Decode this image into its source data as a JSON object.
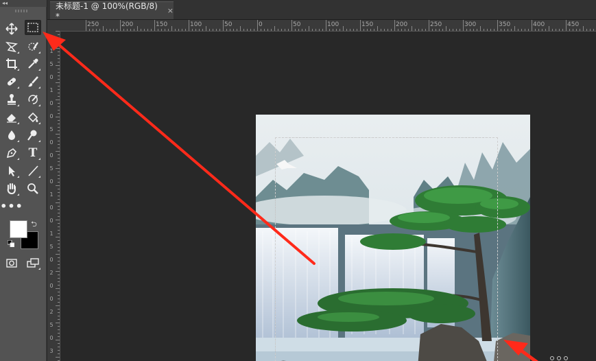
{
  "tab": {
    "title": "未标题-1 @ 100%(RGB/8) *",
    "close": "×"
  },
  "toolbar": {
    "collapse": "◂◂",
    "tools": [
      {
        "name": "move-icon"
      },
      {
        "name": "rect-marquee-icon",
        "active": true
      },
      {
        "name": "lasso-icon"
      },
      {
        "name": "quick-select-icon"
      },
      {
        "name": "crop-icon"
      },
      {
        "name": "eyedropper-icon"
      },
      {
        "name": "healing-icon"
      },
      {
        "name": "brush-icon"
      },
      {
        "name": "stamp-icon"
      },
      {
        "name": "history-brush-icon"
      },
      {
        "name": "eraser-icon"
      },
      {
        "name": "paint-bucket-icon"
      },
      {
        "name": "blur-icon"
      },
      {
        "name": "dodge-icon"
      },
      {
        "name": "pen-icon"
      },
      {
        "name": "type-icon",
        "text": "T"
      },
      {
        "name": "path-select-icon"
      },
      {
        "name": "line-icon"
      },
      {
        "name": "hand-icon"
      },
      {
        "name": "zoom-icon"
      },
      {
        "name": "more-tools-icon",
        "text": "•••"
      }
    ],
    "foreground": "#ffffff",
    "background": "#000000"
  },
  "ruler_h": [
    "250",
    "200",
    "150",
    "100",
    "50",
    "0",
    "50",
    "100",
    "150",
    "200",
    "250",
    "300",
    "350",
    "400",
    "450"
  ],
  "ruler_v": [
    "1",
    "5",
    "0",
    "1",
    "0",
    "0",
    "5",
    "0",
    "0",
    "5",
    "0",
    "1",
    "0",
    "0",
    "1",
    "5",
    "0",
    "2",
    "0",
    "0",
    "2",
    "5",
    "0",
    "3"
  ],
  "accent": "#ff2a1a"
}
